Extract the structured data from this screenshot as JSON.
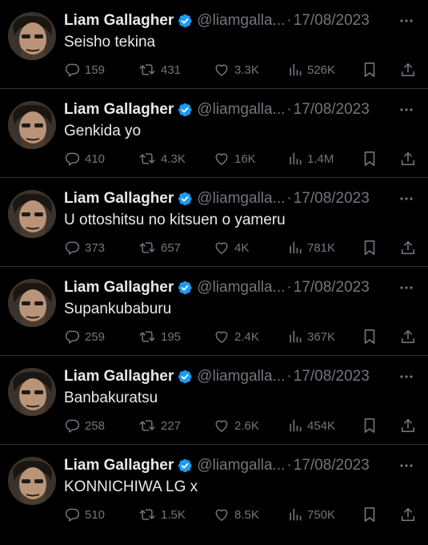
{
  "colors": {
    "background": "#000000",
    "text": "#e7e9ea",
    "muted": "#71767b",
    "verified": "#1d9bf0",
    "divider": "#2f3336"
  },
  "icons": [
    "verified-badge-icon",
    "more-icon",
    "reply-icon",
    "retweet-icon",
    "like-icon",
    "views-icon",
    "bookmark-icon",
    "share-icon"
  ],
  "tweets": [
    {
      "name": "Liam Gallagher",
      "handle": "@liamgalla...",
      "sep": "·",
      "date": "17/08/2023",
      "text": "Seisho tekina",
      "replies": "159",
      "retweets": "431",
      "likes": "3.3K",
      "views": "526K"
    },
    {
      "name": "Liam Gallagher",
      "handle": "@liamgalla...",
      "sep": "·",
      "date": "17/08/2023",
      "text": "Genkida yo",
      "replies": "410",
      "retweets": "4.3K",
      "likes": "16K",
      "views": "1.4M"
    },
    {
      "name": "Liam Gallagher",
      "handle": "@liamgalla...",
      "sep": "·",
      "date": "17/08/2023",
      "text": "U ottoshitsu no kitsuen o yameru",
      "replies": "373",
      "retweets": "657",
      "likes": "4K",
      "views": "781K"
    },
    {
      "name": "Liam Gallagher",
      "handle": "@liamgalla...",
      "sep": "·",
      "date": "17/08/2023",
      "text": "Supankubaburu",
      "replies": "259",
      "retweets": "195",
      "likes": "2.4K",
      "views": "367K"
    },
    {
      "name": "Liam Gallagher",
      "handle": "@liamgalla...",
      "sep": "·",
      "date": "17/08/2023",
      "text": "Banbakuratsu",
      "replies": "258",
      "retweets": "227",
      "likes": "2.6K",
      "views": "454K"
    },
    {
      "name": "Liam Gallagher",
      "handle": "@liamgalla...",
      "sep": "·",
      "date": "17/08/2023",
      "text": "KONNICHIWA LG x",
      "replies": "510",
      "retweets": "1.5K",
      "likes": "8.5K",
      "views": "750K"
    }
  ]
}
